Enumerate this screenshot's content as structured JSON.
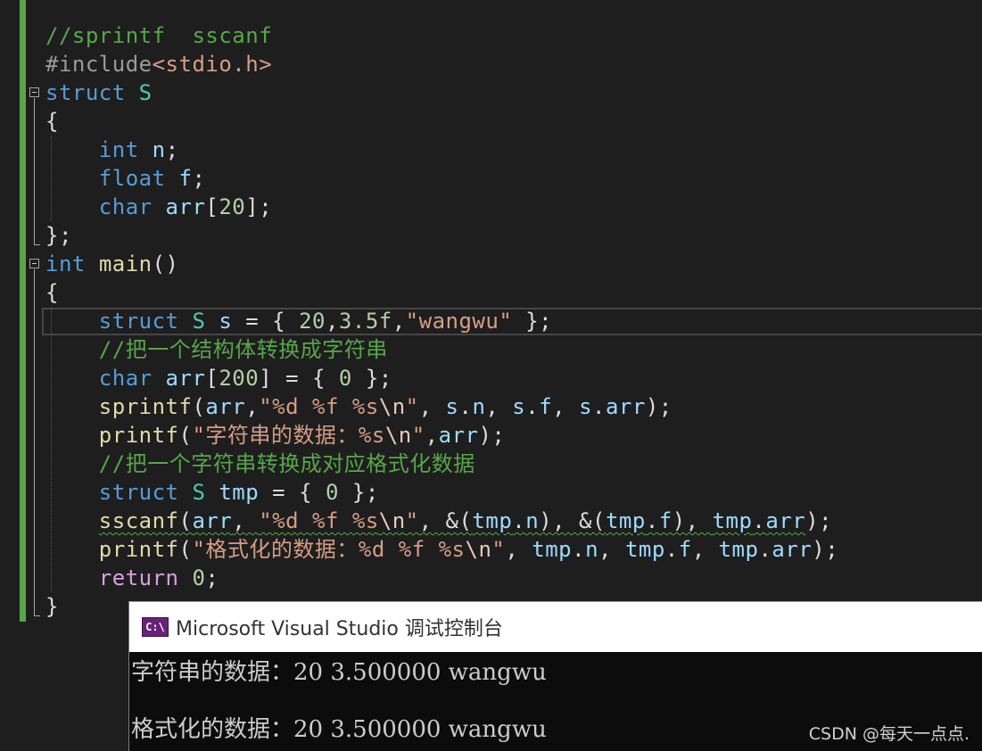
{
  "colors": {
    "editor_bg": "#1e1e1e",
    "keyword": "#569cd6",
    "return_keyword": "#d8a0df",
    "type": "#4ec9b0",
    "function": "#dcdcaa",
    "variable": "#9cdcfe",
    "number": "#b5cea8",
    "string": "#d69d85",
    "comment": "#57a64a",
    "change_bar": "#57a64a",
    "console_bg": "#0c0c0c",
    "console_title_bg": "#ffffff",
    "console_icon": "#68217a"
  },
  "editor": {
    "lines": [
      [
        {
          "c": "cmt",
          "t": "//sprintf  sscanf"
        }
      ],
      [
        {
          "c": "pre",
          "t": "#include"
        },
        {
          "c": "str",
          "t": "<stdio.h>"
        }
      ],
      [
        {
          "c": "kw",
          "t": "struct"
        },
        {
          "c": "pl",
          "t": " "
        },
        {
          "c": "ty",
          "t": "S"
        }
      ],
      [
        {
          "c": "pl",
          "t": "{"
        }
      ],
      [
        {
          "c": "pl",
          "t": "    "
        },
        {
          "c": "kw",
          "t": "int"
        },
        {
          "c": "pl",
          "t": " "
        },
        {
          "c": "var",
          "t": "n"
        },
        {
          "c": "pl",
          "t": ";"
        }
      ],
      [
        {
          "c": "pl",
          "t": "    "
        },
        {
          "c": "kw",
          "t": "float"
        },
        {
          "c": "pl",
          "t": " "
        },
        {
          "c": "var",
          "t": "f"
        },
        {
          "c": "pl",
          "t": ";"
        }
      ],
      [
        {
          "c": "pl",
          "t": "    "
        },
        {
          "c": "kw",
          "t": "char"
        },
        {
          "c": "pl",
          "t": " "
        },
        {
          "c": "var",
          "t": "arr"
        },
        {
          "c": "pl",
          "t": "["
        },
        {
          "c": "num",
          "t": "20"
        },
        {
          "c": "pl",
          "t": "];"
        }
      ],
      [
        {
          "c": "pl",
          "t": "};"
        }
      ],
      [
        {
          "c": "kw",
          "t": "int"
        },
        {
          "c": "pl",
          "t": " "
        },
        {
          "c": "fn",
          "t": "main"
        },
        {
          "c": "pl",
          "t": "()"
        }
      ],
      [
        {
          "c": "pl",
          "t": "{"
        }
      ],
      [
        {
          "c": "pl",
          "t": "    "
        },
        {
          "c": "kw",
          "t": "struct"
        },
        {
          "c": "pl",
          "t": " "
        },
        {
          "c": "ty",
          "t": "S"
        },
        {
          "c": "pl",
          "t": " "
        },
        {
          "c": "var",
          "t": "s"
        },
        {
          "c": "pl",
          "t": " = { "
        },
        {
          "c": "num",
          "t": "20"
        },
        {
          "c": "pl",
          "t": ","
        },
        {
          "c": "num",
          "t": "3.5f"
        },
        {
          "c": "pl",
          "t": ","
        },
        {
          "c": "str",
          "t": "\"wangwu\""
        },
        {
          "c": "pl",
          "t": " };"
        }
      ],
      [
        {
          "c": "pl",
          "t": "    "
        },
        {
          "c": "cmt",
          "t": "//把一个结构体转换成字符串"
        }
      ],
      [
        {
          "c": "pl",
          "t": "    "
        },
        {
          "c": "kw",
          "t": "char"
        },
        {
          "c": "pl",
          "t": " "
        },
        {
          "c": "var",
          "t": "arr"
        },
        {
          "c": "pl",
          "t": "["
        },
        {
          "c": "num",
          "t": "200"
        },
        {
          "c": "pl",
          "t": "] = { "
        },
        {
          "c": "num",
          "t": "0"
        },
        {
          "c": "pl",
          "t": " };"
        }
      ],
      [
        {
          "c": "pl",
          "t": "    "
        },
        {
          "c": "fn",
          "t": "sprintf"
        },
        {
          "c": "pl",
          "t": "("
        },
        {
          "c": "var",
          "t": "arr"
        },
        {
          "c": "pl",
          "t": ","
        },
        {
          "c": "str",
          "t": "\"%d %f %s"
        },
        {
          "c": "esc",
          "t": "\\n"
        },
        {
          "c": "str",
          "t": "\""
        },
        {
          "c": "pl",
          "t": ", "
        },
        {
          "c": "var",
          "t": "s"
        },
        {
          "c": "pl",
          "t": "."
        },
        {
          "c": "var",
          "t": "n"
        },
        {
          "c": "pl",
          "t": ", "
        },
        {
          "c": "var",
          "t": "s"
        },
        {
          "c": "pl",
          "t": "."
        },
        {
          "c": "var",
          "t": "f"
        },
        {
          "c": "pl",
          "t": ", "
        },
        {
          "c": "var",
          "t": "s"
        },
        {
          "c": "pl",
          "t": "."
        },
        {
          "c": "var",
          "t": "arr"
        },
        {
          "c": "pl",
          "t": ");"
        }
      ],
      [
        {
          "c": "pl",
          "t": "    "
        },
        {
          "c": "fn",
          "t": "printf"
        },
        {
          "c": "pl",
          "t": "("
        },
        {
          "c": "str",
          "t": "\"字符串的数据：%s"
        },
        {
          "c": "esc",
          "t": "\\n"
        },
        {
          "c": "str",
          "t": "\""
        },
        {
          "c": "pl",
          "t": ","
        },
        {
          "c": "var",
          "t": "arr"
        },
        {
          "c": "pl",
          "t": ");"
        }
      ],
      [
        {
          "c": "pl",
          "t": "    "
        },
        {
          "c": "cmt",
          "t": "//把一个字符串转换成对应格式化数据"
        }
      ],
      [
        {
          "c": "pl",
          "t": "    "
        },
        {
          "c": "kw",
          "t": "struct"
        },
        {
          "c": "pl",
          "t": " "
        },
        {
          "c": "ty",
          "t": "S"
        },
        {
          "c": "pl",
          "t": " "
        },
        {
          "c": "var",
          "t": "tmp"
        },
        {
          "c": "pl",
          "t": " = { "
        },
        {
          "c": "num",
          "t": "0"
        },
        {
          "c": "pl",
          "t": " };"
        }
      ],
      [
        {
          "c": "pl",
          "t": "    "
        },
        {
          "c": "fn",
          "t": "sscanf",
          "w": true
        },
        {
          "c": "pl",
          "t": "(",
          "w": true
        },
        {
          "c": "var",
          "t": "arr",
          "w": true
        },
        {
          "c": "pl",
          "t": ", ",
          "w": true
        },
        {
          "c": "str",
          "t": "\"%d %f %s",
          "w": true
        },
        {
          "c": "esc",
          "t": "\\n",
          "w": true
        },
        {
          "c": "str",
          "t": "\"",
          "w": true
        },
        {
          "c": "pl",
          "t": ", &(",
          "w": true
        },
        {
          "c": "var",
          "t": "tmp",
          "w": true
        },
        {
          "c": "pl",
          "t": ".",
          "w": true
        },
        {
          "c": "var",
          "t": "n",
          "w": true
        },
        {
          "c": "pl",
          "t": "), &(",
          "w": true
        },
        {
          "c": "var",
          "t": "tmp",
          "w": true
        },
        {
          "c": "pl",
          "t": ".",
          "w": true
        },
        {
          "c": "var",
          "t": "f",
          "w": true
        },
        {
          "c": "pl",
          "t": "), ",
          "w": true
        },
        {
          "c": "var",
          "t": "tmp",
          "w": true
        },
        {
          "c": "pl",
          "t": ".",
          "w": true
        },
        {
          "c": "var",
          "t": "arr",
          "w": true
        },
        {
          "c": "pl",
          "t": ");"
        }
      ],
      [
        {
          "c": "pl",
          "t": "    "
        },
        {
          "c": "fn",
          "t": "printf"
        },
        {
          "c": "pl",
          "t": "("
        },
        {
          "c": "str",
          "t": "\"格式化的数据：%d %f %s"
        },
        {
          "c": "esc",
          "t": "\\n"
        },
        {
          "c": "str",
          "t": "\""
        },
        {
          "c": "pl",
          "t": ", "
        },
        {
          "c": "var",
          "t": "tmp"
        },
        {
          "c": "pl",
          "t": "."
        },
        {
          "c": "var",
          "t": "n"
        },
        {
          "c": "pl",
          "t": ", "
        },
        {
          "c": "var",
          "t": "tmp"
        },
        {
          "c": "pl",
          "t": "."
        },
        {
          "c": "var",
          "t": "f"
        },
        {
          "c": "pl",
          "t": ", "
        },
        {
          "c": "var",
          "t": "tmp"
        },
        {
          "c": "pl",
          "t": "."
        },
        {
          "c": "var",
          "t": "arr"
        },
        {
          "c": "pl",
          "t": ");"
        }
      ],
      [
        {
          "c": "pl",
          "t": "    "
        },
        {
          "c": "ret",
          "t": "return"
        },
        {
          "c": "pl",
          "t": " "
        },
        {
          "c": "num",
          "t": "0"
        },
        {
          "c": "pl",
          "t": ";"
        }
      ],
      [
        {
          "c": "pl",
          "t": "}"
        }
      ]
    ]
  },
  "console": {
    "icon_label": "C:\\",
    "title": "Microsoft Visual Studio 调试控制台",
    "output": [
      "字符串的数据：20 3.500000 wangwu",
      "格式化的数据：20 3.500000 wangwu"
    ]
  },
  "watermark": "CSDN @每天一点点."
}
